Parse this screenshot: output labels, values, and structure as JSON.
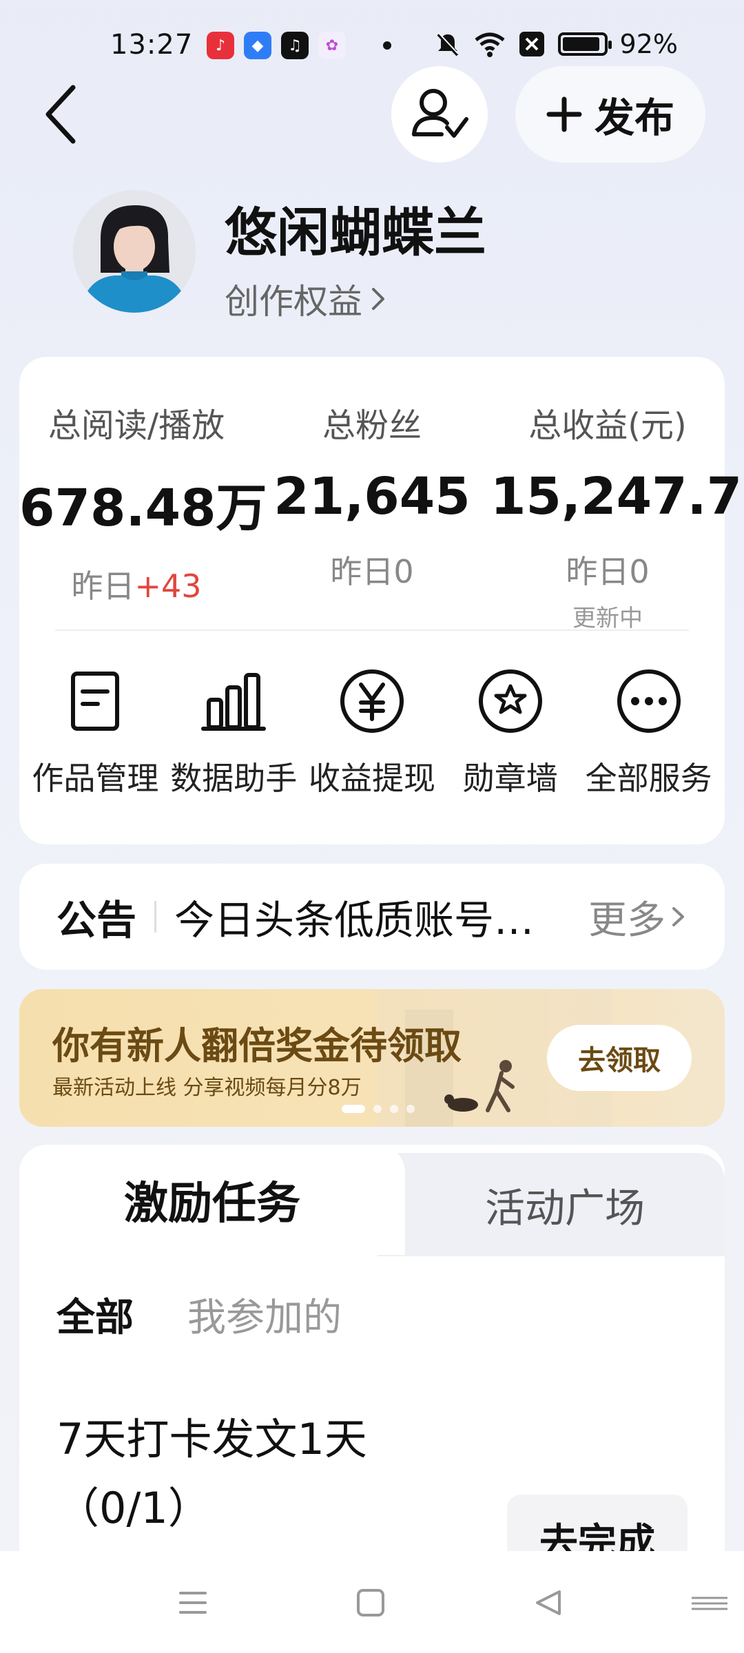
{
  "status_bar": {
    "time": "13:27",
    "battery_text": "92%",
    "battery_level": 0.92,
    "notification_icons": [
      "music-app-icon",
      "browser-app-icon",
      "tiktok-icon",
      "photos-app-icon"
    ],
    "system_icons": [
      "mute-icon",
      "wifi-icon",
      "close-box-icon",
      "battery-icon"
    ]
  },
  "header": {
    "publish_label": "发布",
    "publish_icon": "plus-icon",
    "follow_icon": "user-check-icon"
  },
  "profile": {
    "name": "悠闲蝴蝶兰",
    "rights_link": "创作权益"
  },
  "stats": [
    {
      "label": "总阅读/播放",
      "value": "678.48万",
      "sub_prefix": "昨日",
      "sub_value": "+43",
      "note": ""
    },
    {
      "label": "总粉丝",
      "value": "21,645",
      "sub_prefix": "昨日",
      "sub_value": "0",
      "note": ""
    },
    {
      "label": "总收益(元)",
      "value": "15,247.7",
      "sub_prefix": "昨日",
      "sub_value": "0",
      "note": "更新中"
    }
  ],
  "services": [
    {
      "label": "作品管理",
      "icon": "document-icon"
    },
    {
      "label": "数据助手",
      "icon": "bar-chart-icon"
    },
    {
      "label": "收益提现",
      "icon": "yen-icon"
    },
    {
      "label": "勋章墙",
      "icon": "medal-icon"
    },
    {
      "label": "全部服务",
      "icon": "more-icon"
    }
  ],
  "notice": {
    "tag": "公告",
    "text": "今日头条低质账号…",
    "more": "更多"
  },
  "banner": {
    "title": "你有新人翻倍奖金待领取",
    "subtitle": "最新活动上线 分享视频每月分8万",
    "button": "去领取",
    "colors": {
      "bg": "#f6dfae",
      "text": "#6b4a13"
    }
  },
  "tasks": {
    "tab_active": "激励任务",
    "tab_inactive": "活动广场",
    "filter_all": "全部",
    "filter_mine": "我参加的",
    "items": [
      {
        "title_line1": "7天打卡发文1天",
        "title_line2": "（0/1）",
        "button": "去完成"
      }
    ]
  },
  "nav_bar": {
    "icons": [
      "menu-icon",
      "home-square-icon",
      "back-triangle-icon"
    ]
  }
}
